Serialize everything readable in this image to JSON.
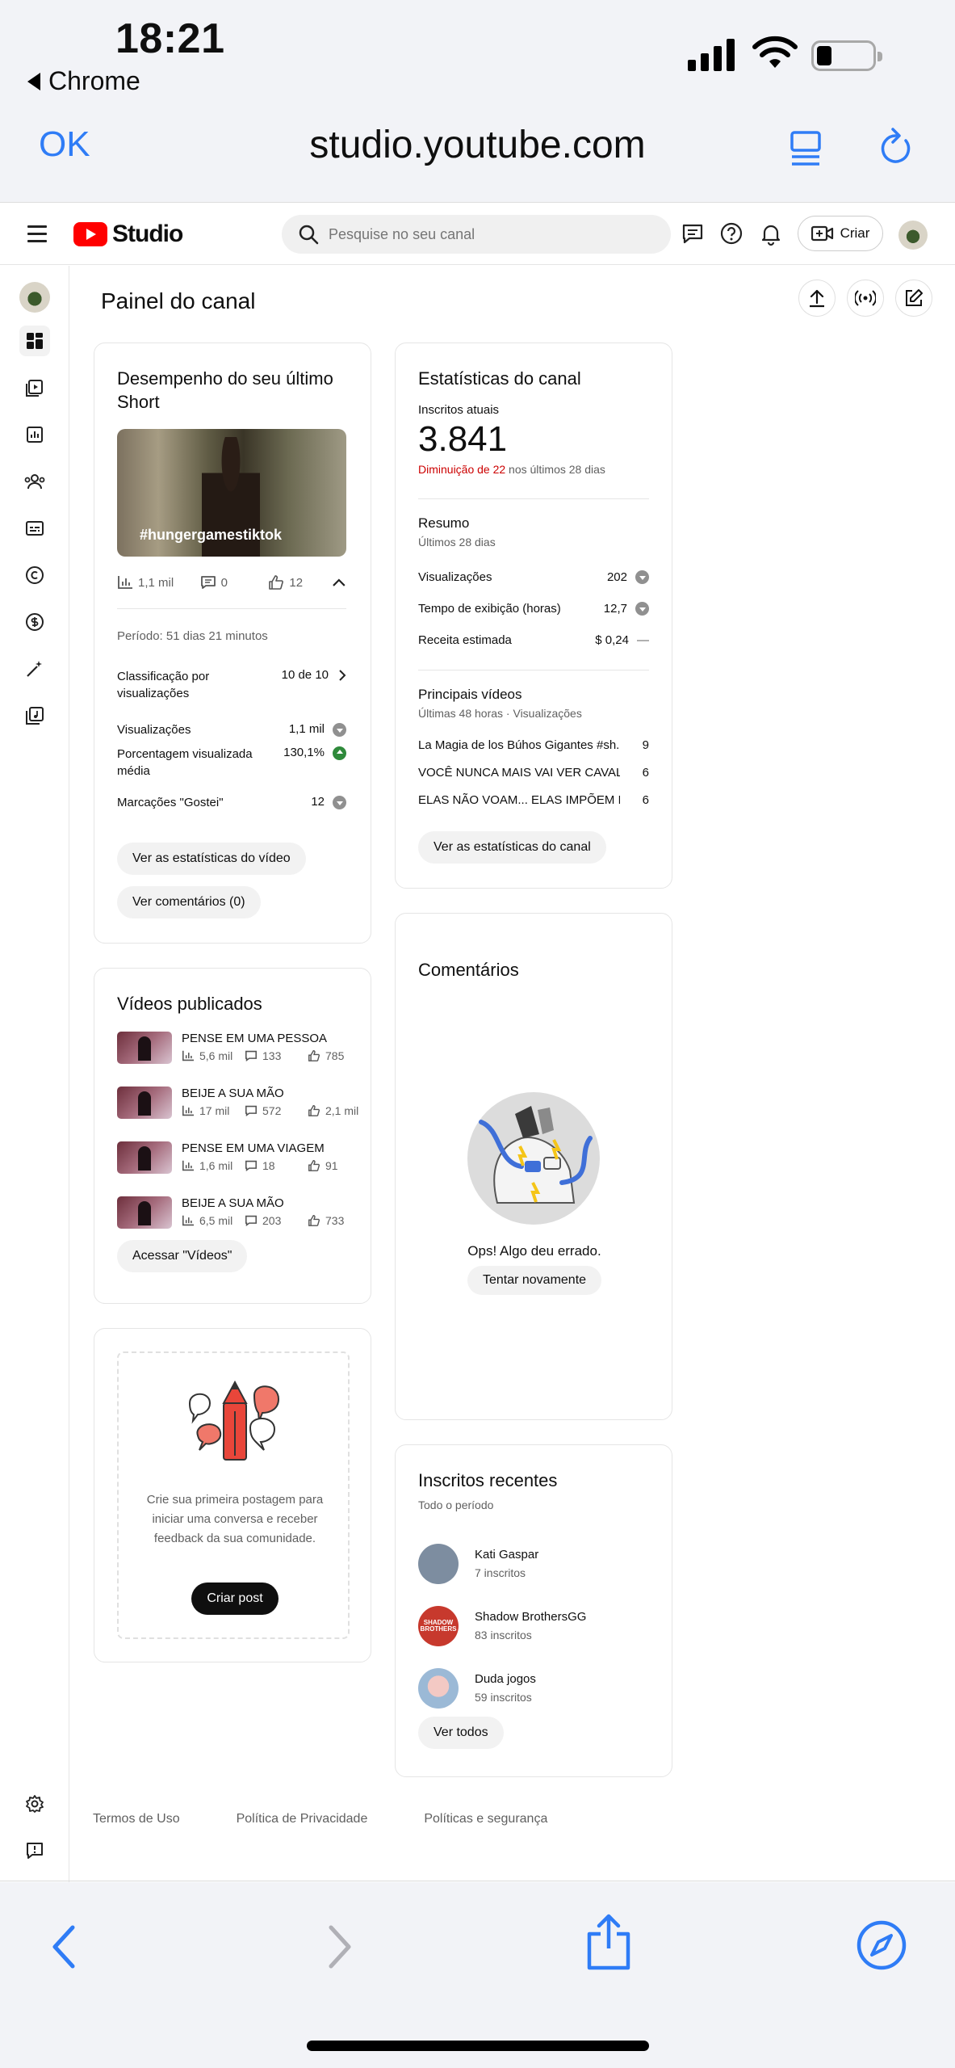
{
  "status_bar": {
    "time": "18:21",
    "back_app": "Chrome"
  },
  "browser": {
    "done_label": "OK",
    "url": "studio.youtube.com"
  },
  "header": {
    "logo_text": "Studio",
    "search_placeholder": "Pesquise no seu canal",
    "create_label": "Criar"
  },
  "page": {
    "title": "Painel do canal"
  },
  "short_card": {
    "title": "Desempenho do seu último Short",
    "thumb_caption": "#hungergamestiktok",
    "views": "1,1 mil",
    "comments": "0",
    "likes": "12",
    "period": "Período: 51 dias 21 minutos",
    "metrics": [
      {
        "label": "Classificação por visualizações",
        "value": "10 de 10",
        "trend": "chevron"
      },
      {
        "label": "Visualizações",
        "value": "1,1 mil",
        "trend": "down"
      },
      {
        "label": "Porcentagem visualizada média",
        "value": "130,1%",
        "trend": "up"
      },
      {
        "label": "Marcações \"Gostei\"",
        "value": "12",
        "trend": "down"
      }
    ],
    "btn_stats": "Ver as estatísticas do vídeo",
    "btn_comments": "Ver comentários (0)"
  },
  "channel_stats": {
    "title": "Estatísticas do canal",
    "subs_label": "Inscritos atuais",
    "subs_value": "3.841",
    "subs_change_red": "Diminuição de 22",
    "subs_change_rest": " nos últimos 28 dias",
    "summary_title": "Resumo",
    "summary_period": "Últimos 28 dias",
    "summary": [
      {
        "label": "Visualizações",
        "value": "202",
        "trend": "down"
      },
      {
        "label": "Tempo de exibição (horas)",
        "value": "12,7",
        "trend": "down"
      },
      {
        "label": "Receita estimada",
        "value": "$ 0,24",
        "trend": "flat"
      }
    ],
    "top_title": "Principais vídeos",
    "top_period": "Últimas 48 horas · Visualizações",
    "top_videos": [
      {
        "title": "La Magia de los Búhos Gigantes #sh...",
        "views": "9"
      },
      {
        "title": "VOCÊ NUNCA MAIS VAI VER CAVAL...",
        "views": "6"
      },
      {
        "title": "ELAS NÃO VOAM... ELAS IMPÕEM R...",
        "views": "6"
      }
    ],
    "btn": "Ver as estatísticas do canal",
    "flat_mark": "—"
  },
  "published": {
    "title": "Vídeos publicados",
    "videos": [
      {
        "title": "PENSE EM UMA PESSOA",
        "views": "5,6 mil",
        "comments": "133",
        "likes": "785"
      },
      {
        "title": "BEIJE A SUA MÃO",
        "views": "17 mil",
        "comments": "572",
        "likes": "2,1 mil"
      },
      {
        "title": "PENSE EM UMA VIAGEM",
        "views": "1,6 mil",
        "comments": "18",
        "likes": "91"
      },
      {
        "title": "BEIJE A SUA MÃO",
        "views": "6,5 mil",
        "comments": "203",
        "likes": "733"
      }
    ],
    "btn": "Acessar \"Vídeos\""
  },
  "comments_card": {
    "title": "Comentários",
    "error": "Ops! Algo deu errado.",
    "retry": "Tentar novamente"
  },
  "post_card": {
    "text": "Crie sua primeira postagem para iniciar uma conversa e receber feedback da sua comunidade.",
    "btn": "Criar post"
  },
  "recent_subs": {
    "title": "Inscritos recentes",
    "period": "Todo o período",
    "subs": [
      {
        "name": "Kati Gaspar",
        "count": "7 inscritos",
        "color": "#7d8da0"
      },
      {
        "name": "Shadow BrothersGG",
        "count": "83 inscritos",
        "color": "#c7392d"
      },
      {
        "name": "Duda jogos",
        "count": "59 inscritos",
        "color": "#9bb9d6"
      }
    ],
    "avatar_text": "SHADOW BROTHERS",
    "btn": "Ver todos"
  },
  "footer": {
    "links": [
      "Termos de Uso",
      "Política de Privacidade",
      "Políticas e segurança"
    ]
  }
}
